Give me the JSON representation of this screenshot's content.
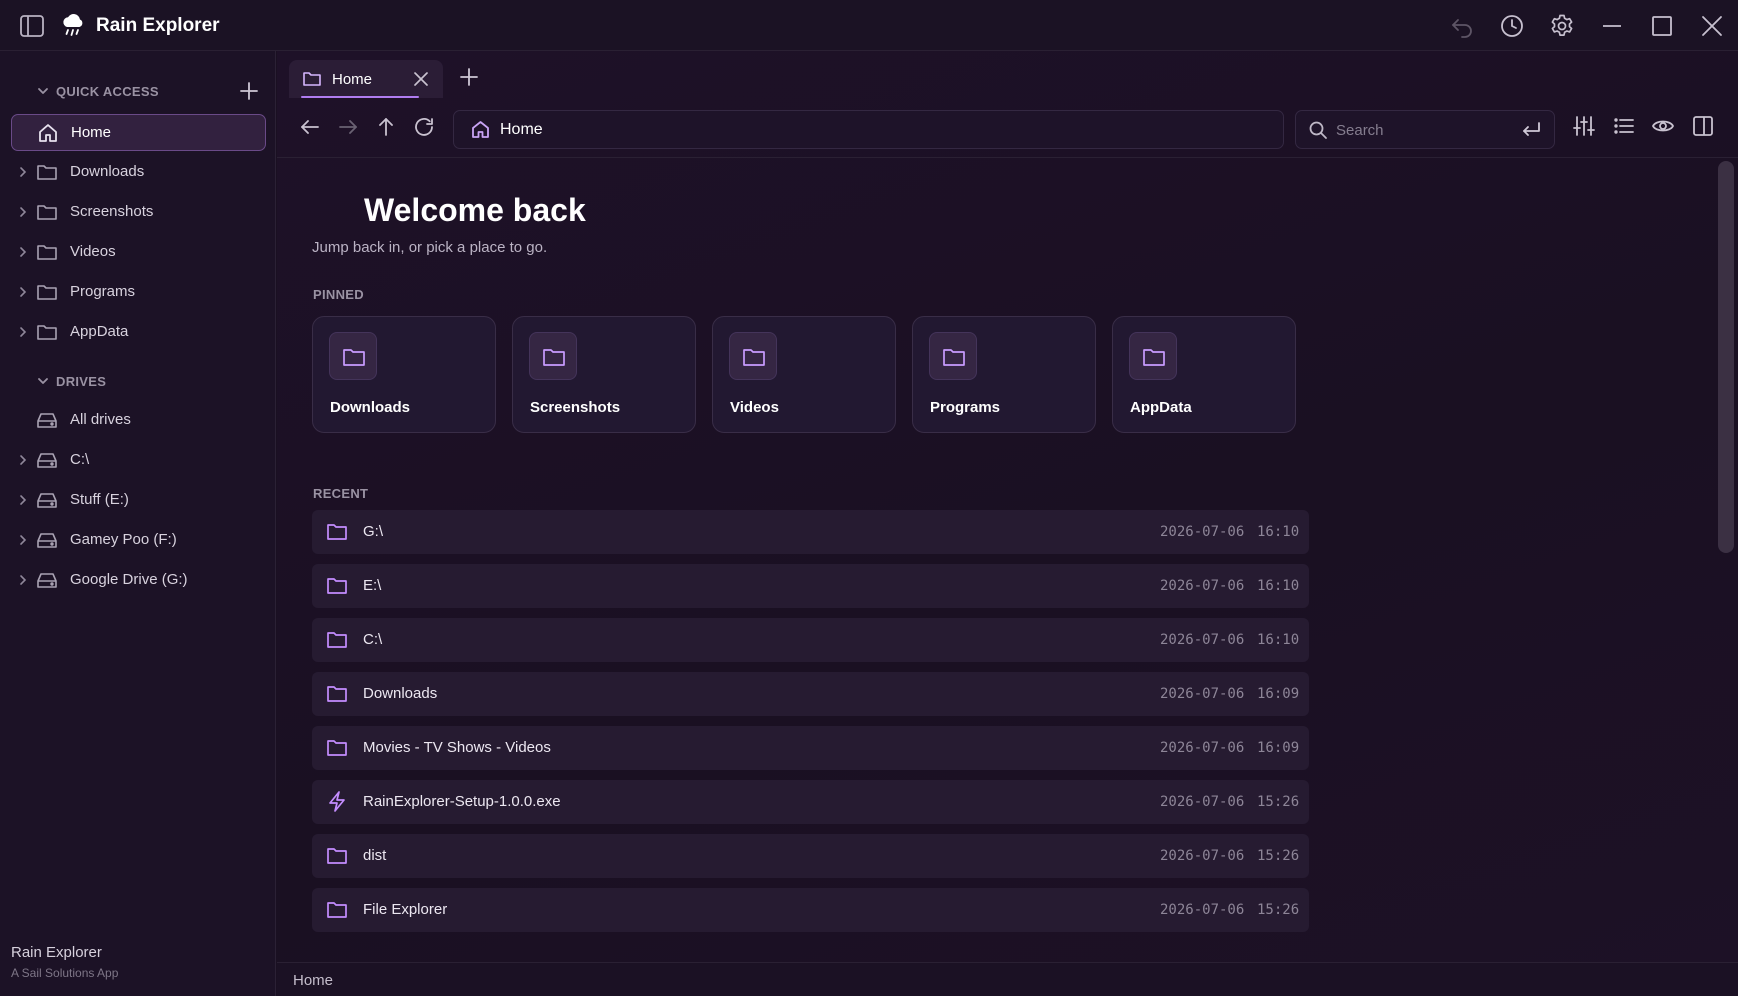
{
  "app": {
    "title": "Rain Explorer",
    "footer_title": "Rain Explorer",
    "footer_subtitle": "A Sail Solutions App"
  },
  "titlebar": {
    "buttons": [
      "sidebar-toggle-icon",
      "undo-icon",
      "history-icon",
      "gear-icon",
      "minimize-icon",
      "maximize-icon",
      "close-icon"
    ]
  },
  "sidebar": {
    "quick_access_label": "QUICK ACCESS",
    "drives_label": "DRIVES",
    "quick_access": [
      {
        "label": "Home",
        "icon": "home-icon",
        "active": true
      },
      {
        "label": "Downloads",
        "icon": "folder-icon"
      },
      {
        "label": "Screenshots",
        "icon": "folder-icon"
      },
      {
        "label": "Videos",
        "icon": "folder-icon"
      },
      {
        "label": "Programs",
        "icon": "folder-icon"
      },
      {
        "label": "AppData",
        "icon": "folder-icon"
      }
    ],
    "drives": [
      {
        "label": "All drives",
        "icon": "drive-icon"
      },
      {
        "label": "C:\\",
        "icon": "drive-icon"
      },
      {
        "label": "Stuff (E:)",
        "icon": "drive-icon"
      },
      {
        "label": "Gamey Poo (F:)",
        "icon": "drive-icon"
      },
      {
        "label": "Google Drive (G:)",
        "icon": "drive-icon"
      }
    ]
  },
  "tabs": [
    {
      "label": "Home",
      "active": true
    }
  ],
  "address": {
    "label": "Home"
  },
  "search": {
    "placeholder": "Search",
    "value": ""
  },
  "home": {
    "welcome": "Welcome back",
    "subtitle": "Jump back in, or pick a place to go.",
    "pinned_label": "PINNED",
    "recent_label": "RECENT",
    "pinned": [
      {
        "label": "Downloads"
      },
      {
        "label": "Screenshots"
      },
      {
        "label": "Videos"
      },
      {
        "label": "Programs"
      },
      {
        "label": "AppData"
      }
    ],
    "recent": [
      {
        "name": "G:\\",
        "date": "2026-07-06",
        "time": "16:10",
        "icon": "folder-icon"
      },
      {
        "name": "E:\\",
        "date": "2026-07-06",
        "time": "16:10",
        "icon": "folder-icon"
      },
      {
        "name": "C:\\",
        "date": "2026-07-06",
        "time": "16:10",
        "icon": "folder-icon"
      },
      {
        "name": "Downloads",
        "date": "2026-07-06",
        "time": "16:09",
        "icon": "folder-icon"
      },
      {
        "name": "Movies - TV Shows - Videos",
        "date": "2026-07-06",
        "time": "16:09",
        "icon": "folder-icon"
      },
      {
        "name": "RainExplorer-Setup-1.0.0.exe",
        "date": "2026-07-06",
        "time": "15:26",
        "icon": "lightning-icon"
      },
      {
        "name": "dist",
        "date": "2026-07-06",
        "time": "15:26",
        "icon": "folder-icon"
      },
      {
        "name": "File Explorer",
        "date": "2026-07-06",
        "time": "15:26",
        "icon": "folder-icon"
      }
    ]
  },
  "statusbar": {
    "text": "Home"
  },
  "colors": {
    "accent": "#b07cf0",
    "folder_icon": "#c48dff",
    "background": "#1a1022",
    "sidebar": "#1c1226",
    "row": "#261b31"
  }
}
